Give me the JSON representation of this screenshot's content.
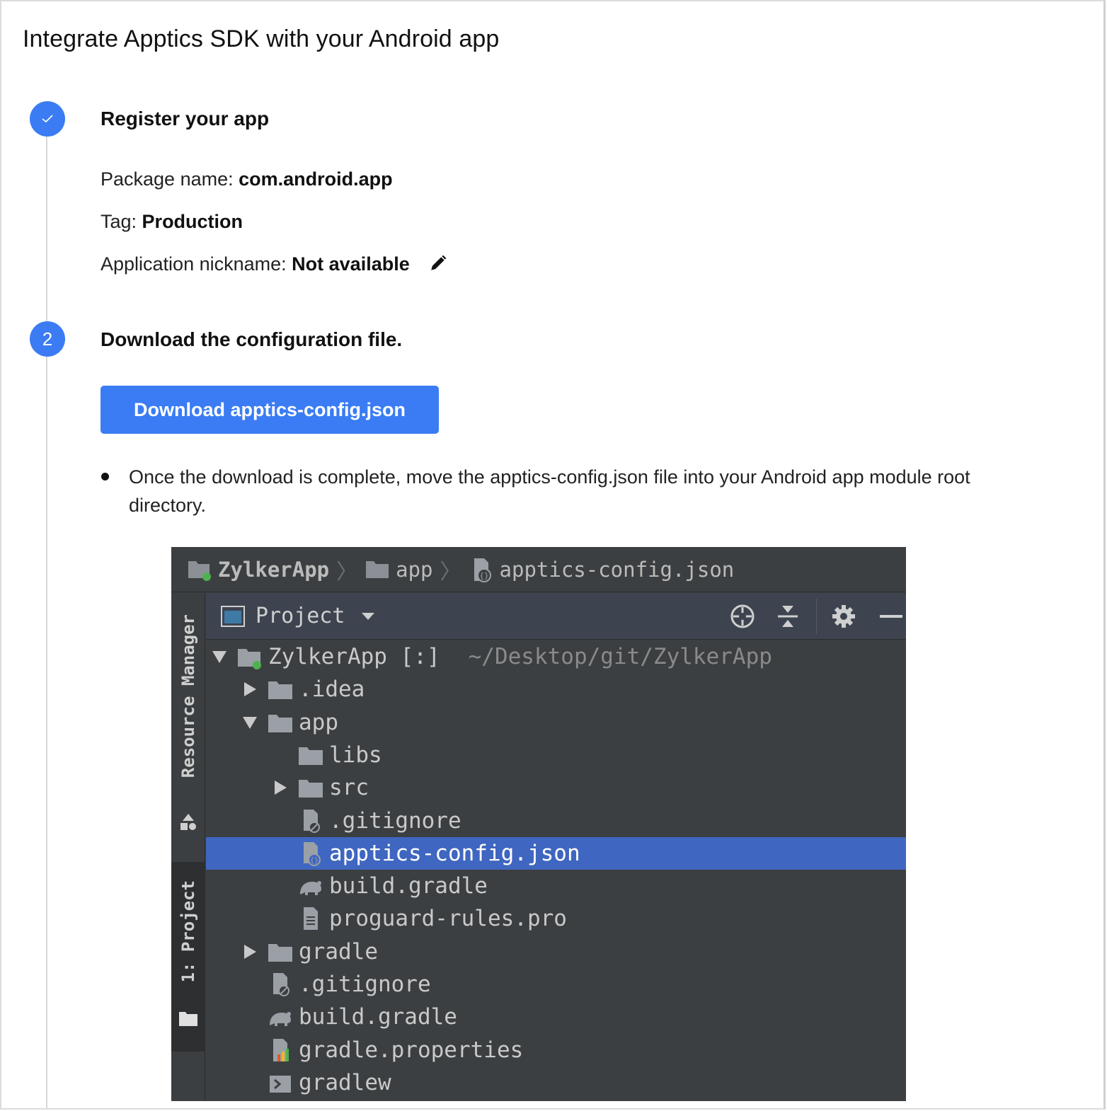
{
  "page": {
    "title": "Integrate Apptics SDK with your Android app"
  },
  "step1": {
    "badge": "",
    "title": "Register your app",
    "package_label": "Package name: ",
    "package_value": "com.android.app",
    "tag_label": "Tag: ",
    "tag_value": "Production",
    "nickname_label": "Application nickname: ",
    "nickname_value": "Not available",
    "edit_icon": "pencil-icon"
  },
  "step2": {
    "badge": "2",
    "title": "Download the configuration file.",
    "button_label": "Download apptics-config.json",
    "bullet_text": "Once the download is complete, move the apptics-config.json file into your Android app module root directory."
  },
  "ide": {
    "breadcrumb": [
      "ZylkerApp",
      "app",
      "apptics-config.json"
    ],
    "side_tabs": {
      "resource_manager": "Resource Manager",
      "project": "1: Project"
    },
    "toolbar": {
      "view_label": "Project"
    },
    "tree": [
      {
        "label": "ZylkerApp [:]",
        "path": "~/Desktop/git/ZylkerApp",
        "icon": "module-folder-icon",
        "arrow": "expanded",
        "level": 0
      },
      {
        "label": ".idea",
        "icon": "folder-icon",
        "arrow": "collapsed",
        "level": 1
      },
      {
        "label": "app",
        "icon": "folder-icon",
        "arrow": "expanded",
        "level": 1
      },
      {
        "label": "libs",
        "icon": "folder-icon",
        "arrow": "none",
        "level": 2
      },
      {
        "label": "src",
        "icon": "folder-icon",
        "arrow": "collapsed",
        "level": 2
      },
      {
        "label": ".gitignore",
        "icon": "gitignore-file-icon",
        "arrow": "none",
        "level": 2
      },
      {
        "label": "apptics-config.json",
        "icon": "json-file-icon",
        "arrow": "none",
        "level": 2,
        "selected": true
      },
      {
        "label": "build.gradle",
        "icon": "gradle-elephant-icon",
        "arrow": "none",
        "level": 2
      },
      {
        "label": "proguard-rules.pro",
        "icon": "text-file-icon",
        "arrow": "none",
        "level": 2
      },
      {
        "label": "gradle",
        "icon": "folder-icon",
        "arrow": "collapsed",
        "level": 1
      },
      {
        "label": ".gitignore",
        "icon": "gitignore-file-icon",
        "arrow": "none",
        "level": 1
      },
      {
        "label": "build.gradle",
        "icon": "gradle-elephant-icon",
        "arrow": "none",
        "level": 1
      },
      {
        "label": "gradle.properties",
        "icon": "properties-file-icon",
        "arrow": "none",
        "level": 1
      },
      {
        "label": "gradlew",
        "icon": "script-file-icon",
        "arrow": "none",
        "level": 1
      }
    ]
  },
  "colors": {
    "accent": "#3b7cf4",
    "ide_bg": "#3c3f41",
    "ide_selection": "#3f66c0"
  }
}
